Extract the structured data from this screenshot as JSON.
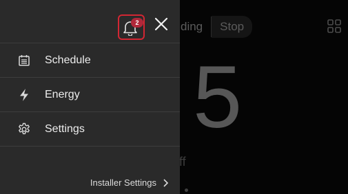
{
  "background": {
    "top_buttons": [
      "ding",
      "Stop"
    ],
    "big_number": "5",
    "mode_text": "ff"
  },
  "drawer": {
    "notifications": {
      "count": "2",
      "icon": "bell-icon",
      "highlight_color": "#d32633"
    },
    "close_icon": "close-icon",
    "menu": [
      {
        "label": "Schedule",
        "icon": "calendar-icon"
      },
      {
        "label": "Energy",
        "icon": "lightning-icon"
      },
      {
        "label": "Settings",
        "icon": "gear-icon"
      }
    ],
    "installer_link": "Installer Settings",
    "installer_icon": "chevron-right-icon"
  },
  "colors": {
    "drawer_bg": "#2a2a2a",
    "screen_bg": "#050505",
    "badge_bg": "#b1283a"
  }
}
